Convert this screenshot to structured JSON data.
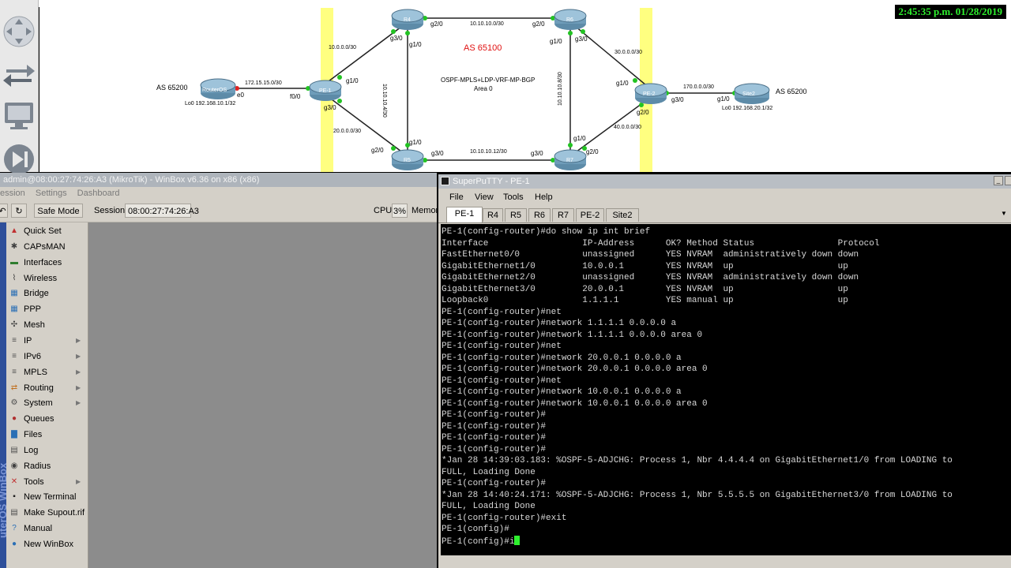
{
  "clock": "2:45:35 p.m. 01/28/2019",
  "topology": {
    "as_left": "AS 65200",
    "as_right": "AS 65200",
    "as_center": "AS 65100",
    "proto_line1": "OSPF-MPLS+LDP-VRF-MP-BGP",
    "proto_line2": "Area 0",
    "routers": {
      "routeros": "RouterOS",
      "pe1": "PE-1",
      "r4": "R4",
      "r5": "R5",
      "r6": "R6",
      "r7": "R7",
      "pe2": "PE-2",
      "site2": "Site2"
    },
    "lo_left": "Lo0 192.168.10.1/32",
    "lo_right": "Lo0 192.168.20.1/32",
    "subnets": {
      "ros_pe1": "172.15.15.0/30",
      "pe1_r4": "10.0.0.0/30",
      "pe1_r5": "20.0.0.0/30",
      "r4_r6": "10.10.10.0/30",
      "r4_r5": "10.10.10.4/30",
      "r6_r7": "10.10.10.8/30",
      "r5_r7": "10.10.10.12/30",
      "r6_pe2": "30.0.0.0/30",
      "r7_pe2": "40.0.0.0/30",
      "pe2_site2": "170.0.0.0/30"
    },
    "ports": {
      "ros_e0": "e0",
      "pe1_f0": "f0/0",
      "pe1_g10": "g1/0",
      "pe1_g30": "g3/0",
      "r4_g30": "g3/0",
      "r4_g20": "g2/0",
      "r4_g10": "g1/0",
      "r6_g20": "g2/0",
      "r6_g30": "g3/0",
      "r6_g10": "g1/0",
      "r5_g20": "g2/0",
      "r5_g10": "g1/0",
      "r5_g30": "g3/0",
      "r7_g30": "g3/0",
      "r7_g10": "g1/0",
      "r7_g20": "g2/0",
      "pe2_g10": "g1/0",
      "pe2_g20": "g2/0",
      "pe2_g30": "g3/0",
      "site2_g10": "g1/0"
    }
  },
  "winbox": {
    "title": "admin@08:00:27:74:26:A3 (MikroTik) - WinBox v6.36 on x86 (x86)",
    "menu": [
      "ession",
      "Settings",
      "Dashboard"
    ],
    "safe_mode": "Safe Mode",
    "session_label": "Session:",
    "session_value": "08:00:27:74:26:A3",
    "cpu_label": "CPU:",
    "cpu_value": "3%",
    "memory_label": "Memor",
    "brand": "uterOS WinBox",
    "nav": [
      {
        "label": "Quick Set",
        "icon": "quick-set",
        "color": "#c03030",
        "glyph": "▲",
        "arrow": false
      },
      {
        "label": "CAPsMAN",
        "icon": "capsman",
        "color": "#404040",
        "glyph": "✱",
        "arrow": false
      },
      {
        "label": "Interfaces",
        "icon": "interfaces",
        "color": "#2f7d2f",
        "glyph": "▬",
        "arrow": false
      },
      {
        "label": "Wireless",
        "icon": "wireless",
        "color": "#404040",
        "glyph": "⌇",
        "arrow": false
      },
      {
        "label": "Bridge",
        "icon": "bridge",
        "color": "#2a6fb5",
        "glyph": "▦",
        "arrow": false
      },
      {
        "label": "PPP",
        "icon": "ppp",
        "color": "#2a6fb5",
        "glyph": "▦",
        "arrow": false
      },
      {
        "label": "Mesh",
        "icon": "mesh",
        "color": "#404040",
        "glyph": "✣",
        "arrow": false
      },
      {
        "label": "IP",
        "icon": "ip",
        "color": "#505050",
        "glyph": "≡",
        "arrow": true
      },
      {
        "label": "IPv6",
        "icon": "ipv6",
        "color": "#505050",
        "glyph": "≡",
        "arrow": true
      },
      {
        "label": "MPLS",
        "icon": "mpls",
        "color": "#505050",
        "glyph": "≡",
        "arrow": true
      },
      {
        "label": "Routing",
        "icon": "routing",
        "color": "#c07020",
        "glyph": "⇄",
        "arrow": true
      },
      {
        "label": "System",
        "icon": "system",
        "color": "#505050",
        "glyph": "⚙",
        "arrow": true
      },
      {
        "label": "Queues",
        "icon": "queues",
        "color": "#b03030",
        "glyph": "●",
        "arrow": false
      },
      {
        "label": "Files",
        "icon": "files",
        "color": "#2a6fb5",
        "glyph": "▇",
        "arrow": false
      },
      {
        "label": "Log",
        "icon": "log",
        "color": "#505050",
        "glyph": "▤",
        "arrow": false
      },
      {
        "label": "Radius",
        "icon": "radius",
        "color": "#404040",
        "glyph": "◉",
        "arrow": false
      },
      {
        "label": "Tools",
        "icon": "tools",
        "color": "#c03030",
        "glyph": "✕",
        "arrow": true
      },
      {
        "label": "New Terminal",
        "icon": "terminal",
        "color": "#202020",
        "glyph": "▪",
        "arrow": false
      },
      {
        "label": "Make Supout.rif",
        "icon": "supout",
        "color": "#505050",
        "glyph": "▤",
        "arrow": false
      },
      {
        "label": "Manual",
        "icon": "manual",
        "color": "#2a6fb5",
        "glyph": "?",
        "arrow": false
      },
      {
        "label": "New WinBox",
        "icon": "new-winbox",
        "color": "#2a6fb5",
        "glyph": "●",
        "arrow": false
      }
    ]
  },
  "superputty": {
    "title": "SuperPuTTY - PE-1",
    "menu": [
      "File",
      "View",
      "Tools",
      "Help"
    ],
    "tabs": [
      "PE-1",
      "R4",
      "R5",
      "R6",
      "R7",
      "PE-2",
      "Site2"
    ],
    "active_tab": "PE-1",
    "terminal_lines": [
      "PE-1(config-router)#do show ip int brief",
      "Interface                  IP-Address      OK? Method Status                Protocol",
      "FastEthernet0/0            unassigned      YES NVRAM  administratively down down",
      "GigabitEthernet1/0         10.0.0.1        YES NVRAM  up                    up",
      "GigabitEthernet2/0         unassigned      YES NVRAM  administratively down down",
      "GigabitEthernet3/0         20.0.0.1        YES NVRAM  up                    up",
      "Loopback0                  1.1.1.1         YES manual up                    up",
      "PE-1(config-router)#net",
      "PE-1(config-router)#network 1.1.1.1 0.0.0.0 a",
      "PE-1(config-router)#network 1.1.1.1 0.0.0.0 area 0",
      "PE-1(config-router)#net",
      "PE-1(config-router)#network 20.0.0.1 0.0.0.0 a",
      "PE-1(config-router)#network 20.0.0.1 0.0.0.0 area 0",
      "PE-1(config-router)#net",
      "PE-1(config-router)#network 10.0.0.1 0.0.0.0 a",
      "PE-1(config-router)#network 10.0.0.1 0.0.0.0 area 0",
      "PE-1(config-router)#",
      "PE-1(config-router)#",
      "PE-1(config-router)#",
      "PE-1(config-router)#",
      "*Jan 28 14:39:03.183: %OSPF-5-ADJCHG: Process 1, Nbr 4.4.4.4 on GigabitEthernet1/0 from LOADING to",
      "FULL, Loading Done",
      "PE-1(config-router)#",
      "*Jan 28 14:40:24.171: %OSPF-5-ADJCHG: Process 1, Nbr 5.5.5.5 on GigabitEthernet3/0 from LOADING to",
      "FULL, Loading Done",
      "PE-1(config-router)#exit",
      "PE-1(config)#",
      "PE-1(config)#i"
    ]
  }
}
